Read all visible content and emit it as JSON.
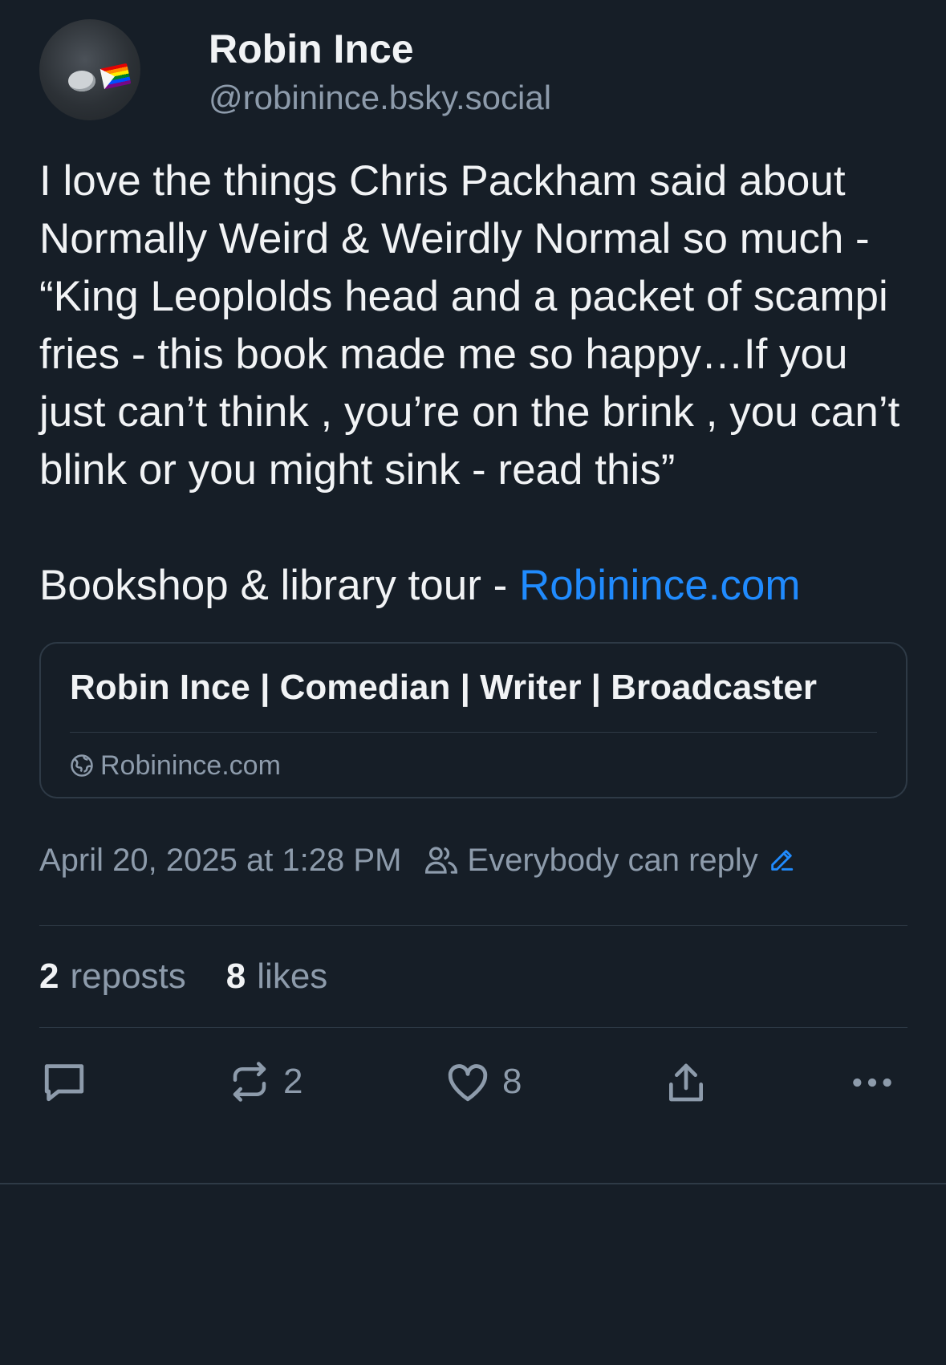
{
  "author": {
    "display_name": "Robin Ince",
    "handle": "@robinince.bsky.social"
  },
  "post": {
    "text": "I love the things Chris Packham said about Normally Weird & Weirdly Normal so much - “King Leoplolds head and a packet of scampi fries - this book made me so happy…If you just can’t think , you’re on the brink , you can’t blink or you might sink - read this”",
    "tour_text": "Bookshop & library tour - ",
    "tour_link": "Robinince.com"
  },
  "link_card": {
    "title": "Robin Ince | Comedian | Writer | Broadcaster",
    "domain": "Robinince.com"
  },
  "meta": {
    "timestamp": "April 20, 2025 at 1:28 PM",
    "reply_setting": "Everybody can reply"
  },
  "stats": {
    "reposts_count": "2",
    "reposts_label": "reposts",
    "likes_count": "8",
    "likes_label": "likes"
  },
  "actions": {
    "repost_count": "2",
    "like_count": "8"
  },
  "colors": {
    "background": "#161e27",
    "text": "#f1f3f5",
    "muted": "#8d9bab",
    "link": "#208bfe",
    "border": "#2e3a46"
  }
}
